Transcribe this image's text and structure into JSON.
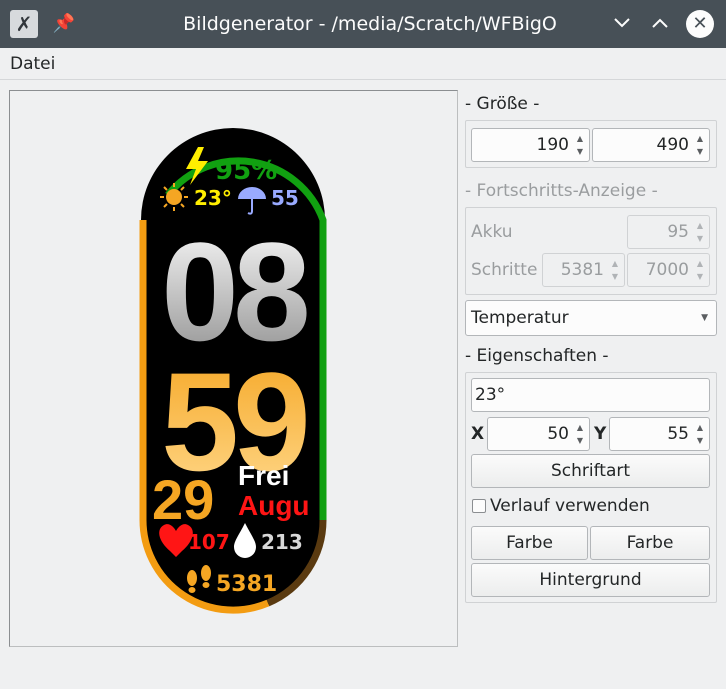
{
  "window": {
    "title": "Bildgenerator - /media/Scratch/WFBigO",
    "app_icon": "x-app-icon",
    "controls": [
      "pin-icon",
      "minimize-icon",
      "maximize-icon",
      "close-icon"
    ]
  },
  "menu": {
    "file": "Datei"
  },
  "watch": {
    "battery": "95%",
    "temperature": "23°",
    "rain": "55",
    "hour": "08",
    "minute": "59",
    "day": "29",
    "weekday": "Frei",
    "month": "Augu",
    "heart_rate": "107",
    "humidity": "213",
    "steps": "5381",
    "colors": {
      "green": "#11a011",
      "orange": "#f39c12",
      "red": "#ff1515",
      "yellow": "#ffee00",
      "blue": "#99aaff"
    }
  },
  "size_group": {
    "label": "- Größe -",
    "width": "190",
    "height": "490"
  },
  "progress_group": {
    "label": "- Fortschritts-Anzeige -",
    "battery_label": "Akku",
    "battery_value": "95",
    "steps_label": "Schritte",
    "steps_value": "5381",
    "steps_goal": "7000"
  },
  "element_select": {
    "selected": "Temperatur"
  },
  "properties_group": {
    "label": "- Eigenschaften -",
    "text": "23°",
    "x_label": "X",
    "x_value": "50",
    "y_label": "Y",
    "y_value": "55",
    "font_button": "Schriftart",
    "gradient_label": "Verlauf verwenden",
    "gradient_checked": false,
    "color_button_1": "Farbe",
    "color_button_2": "Farbe",
    "background_button": "Hintergrund"
  }
}
